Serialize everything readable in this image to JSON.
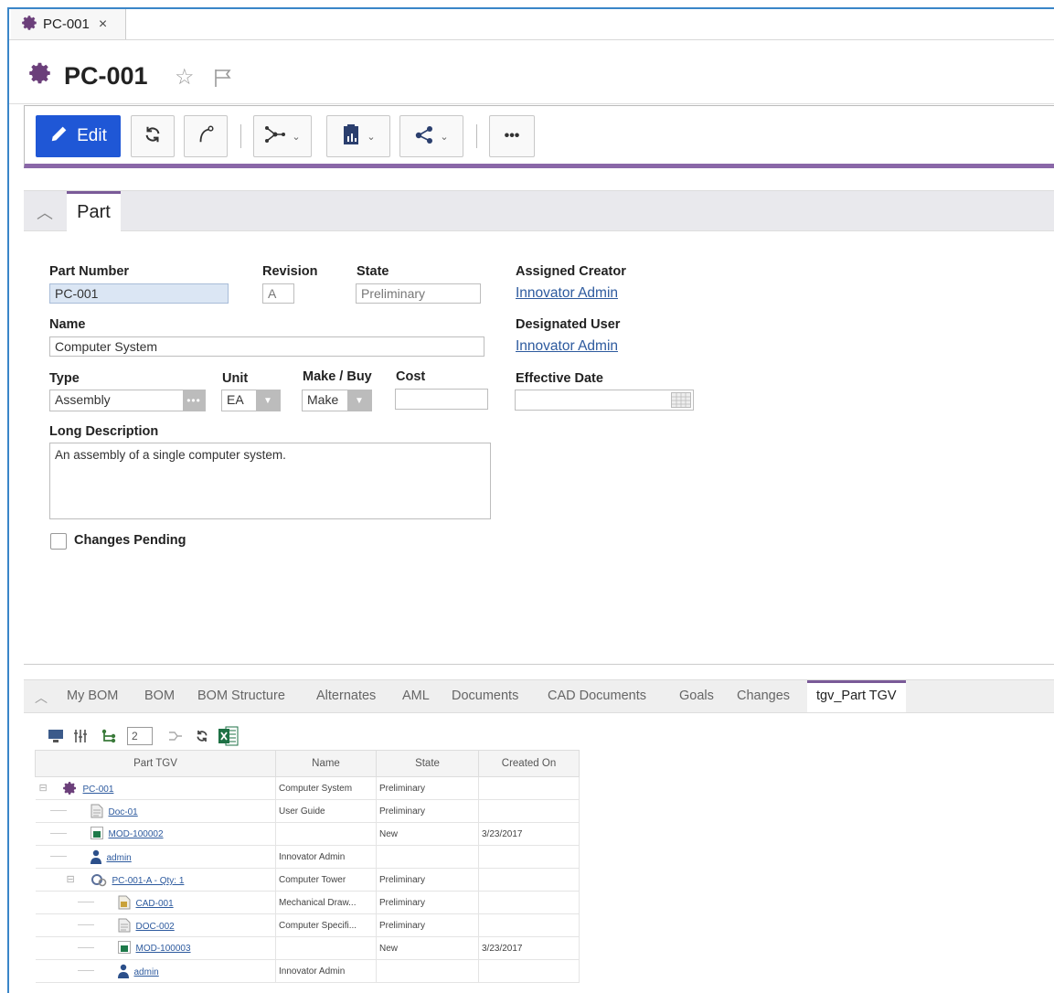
{
  "tab": {
    "label": "PC-001",
    "close": "×"
  },
  "header": {
    "title": "PC-001"
  },
  "toolbar": {
    "edit_label": "Edit",
    "more_label": "•••"
  },
  "section": {
    "tab_label": "Part"
  },
  "form": {
    "part_number": {
      "label": "Part Number",
      "value": "PC-001"
    },
    "revision": {
      "label": "Revision",
      "value": "A"
    },
    "state": {
      "label": "State",
      "value": "Preliminary"
    },
    "assigned_creator": {
      "label": "Assigned Creator",
      "value": "Innovator Admin"
    },
    "name": {
      "label": "Name",
      "value": "Computer System"
    },
    "designated_user": {
      "label": "Designated User",
      "value": "Innovator Admin"
    },
    "type": {
      "label": "Type",
      "value": "Assembly"
    },
    "unit": {
      "label": "Unit",
      "value": "EA"
    },
    "make_buy": {
      "label": "Make / Buy",
      "value": "Make"
    },
    "cost": {
      "label": "Cost",
      "value": ""
    },
    "effective_date": {
      "label": "Effective Date",
      "value": ""
    },
    "long_description": {
      "label": "Long Description",
      "value": "An assembly of a single computer system."
    },
    "changes_pending": {
      "label": "Changes Pending",
      "checked": false
    }
  },
  "relationship_tabs": [
    "My BOM",
    "BOM",
    "BOM Structure",
    "Alternates",
    "AML",
    "Documents",
    "CAD Documents",
    "Goals",
    "Changes",
    "tgv_Part TGV"
  ],
  "grid": {
    "levels_value": "2",
    "columns": [
      "Part TGV",
      "Name",
      "State",
      "Created On"
    ],
    "rows": [
      {
        "label": "PC-001",
        "name": "Computer System",
        "state": "Preliminary",
        "created": "",
        "icon": "gear-icon",
        "indent": 0,
        "expander": "⊟"
      },
      {
        "label": "Doc-01",
        "name": "User Guide",
        "state": "Preliminary",
        "created": "",
        "icon": "document-icon",
        "indent": 1
      },
      {
        "label": "MOD-100002",
        "name": "",
        "state": "New",
        "created": "3/23/2017",
        "icon": "model-icon",
        "indent": 1
      },
      {
        "label": "admin",
        "name": "Innovator Admin",
        "state": "",
        "created": "",
        "icon": "user-icon",
        "indent": 1
      },
      {
        "label": "PC-001-A - Qty: 1",
        "name": "Computer Tower",
        "state": "Preliminary",
        "created": "",
        "icon": "assembly-icon",
        "indent": 1,
        "expander": "⊟"
      },
      {
        "label": "CAD-001",
        "name": "Mechanical Draw...",
        "state": "Preliminary",
        "created": "",
        "icon": "cad-icon",
        "indent": 2
      },
      {
        "label": "DOC-002",
        "name": "Computer Specifi...",
        "state": "Preliminary",
        "created": "",
        "icon": "document-icon",
        "indent": 2
      },
      {
        "label": "MOD-100003",
        "name": "",
        "state": "New",
        "created": "3/23/2017",
        "icon": "model-icon",
        "indent": 2
      },
      {
        "label": "admin",
        "name": "Innovator Admin",
        "state": "",
        "created": "",
        "icon": "user-icon",
        "indent": 2
      }
    ]
  },
  "colors": {
    "accent_purple": "#7a5a98",
    "edit_blue": "#1f57d6",
    "link_blue": "#2d5a9e",
    "frame_blue": "#3a86c8",
    "gear_purple": "#6b3f7a"
  }
}
